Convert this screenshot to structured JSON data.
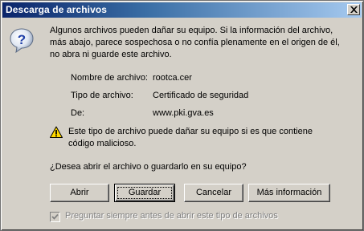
{
  "window": {
    "title": "Descarga de archivos"
  },
  "message": "Algunos archivos pueden dañar su equipo. Si la información del archivo, más abajo, parece sospechosa o no confía plenamente en el origen de él, no abra ni guarde este archivo.",
  "details": [
    {
      "label": "Nombre de archivo:",
      "value": "rootca.cer"
    },
    {
      "label": "Tipo de archivo:",
      "value": "Certificado de seguridad"
    },
    {
      "label": "De:",
      "value": "www.pki.gva.es"
    }
  ],
  "danger_message": "Este tipo de archivo puede dañar su equipo si es que contiene código malicioso.",
  "question": "¿Desea abrir el archivo o guardarlo en su equipo?",
  "buttons": {
    "open": "Abrir",
    "save": "Guardar",
    "cancel": "Cancelar",
    "more_info": "Más información"
  },
  "checkbox": {
    "label": "Preguntar siempre antes de abrir este tipo de archivos",
    "checked": true,
    "enabled": false
  },
  "icons": {
    "question": "question-icon",
    "warning": "warning-icon",
    "close": "close-icon"
  },
  "colors": {
    "titlebar_start": "#0a246a",
    "titlebar_end": "#a6caf0",
    "face": "#d4d0c8"
  }
}
